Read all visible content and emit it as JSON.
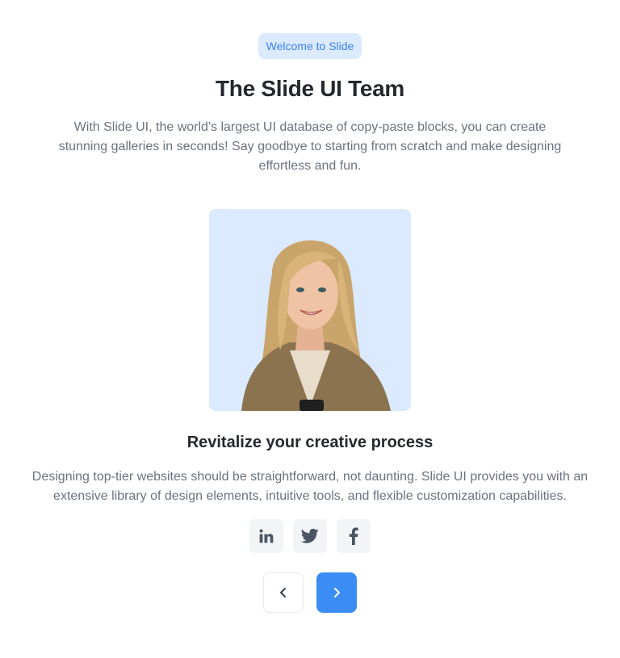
{
  "hero": {
    "badge": "Welcome to Slide",
    "title": "The Slide UI Team",
    "description": "With Slide UI, the world's largest UI database of copy-paste blocks, you can create stunning galleries in seconds! Say goodbye to starting from scratch and make designing effortless and fun."
  },
  "member": {
    "title": "Revitalize your creative process",
    "description": "Designing top-tier websites should be straightforward, not daunting. Slide UI provides you with an extensive library of design elements, intuitive tools, and flexible customization capabilities.",
    "photo_icon": "portrait-photo"
  },
  "socials": [
    {
      "name": "linkedin",
      "icon": "linkedin-icon"
    },
    {
      "name": "twitter",
      "icon": "twitter-icon"
    },
    {
      "name": "facebook",
      "icon": "facebook-icon"
    }
  ],
  "navigation": {
    "prev_icon": "chevron-left-icon",
    "next_icon": "chevron-right-icon"
  },
  "colors": {
    "accent": "#3b8df5",
    "badge_bg": "#dbeafe",
    "badge_text": "#3b82f6",
    "photo_bg": "#dbeafe",
    "social_bg": "#f3f4f6",
    "heading": "#25282d",
    "body_text": "#6b7280"
  }
}
